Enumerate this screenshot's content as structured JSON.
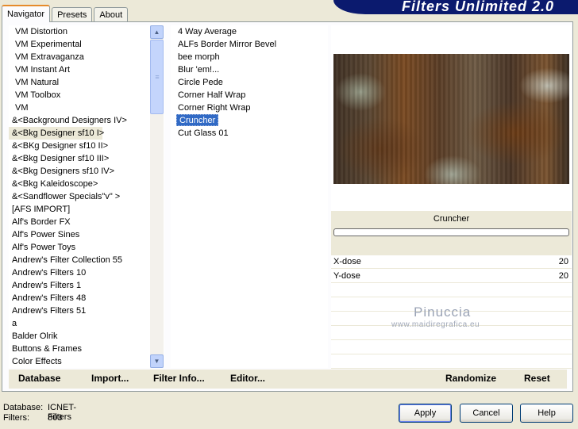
{
  "tabs": [
    {
      "label": "Navigator",
      "active": true
    },
    {
      "label": "Presets",
      "active": false
    },
    {
      "label": "About",
      "active": false
    }
  ],
  "banner": {
    "title": "Filters Unlimited 2.0",
    "color": "#0b1a6e"
  },
  "categories": {
    "items": [
      "VM Distortion",
      "VM Experimental",
      "VM Extravaganza",
      "VM Instant Art",
      "VM Natural",
      "VM Toolbox",
      "VM",
      "&<Background Designers IV>",
      "&<Bkg Designer sf10 I>",
      "&<BKg Designer sf10 II>",
      "&<Bkg Designer sf10 III>",
      "&<Bkg Designers sf10 IV>",
      "&<Bkg Kaleidoscope>",
      "&<Sandflower Specials\"v\" >",
      "[AFS IMPORT]",
      "Alf's Border FX",
      "Alf's Power Sines",
      "Alf's Power Toys",
      "Andrew's Filter Collection 55",
      "Andrew's Filters 10",
      "Andrew's Filters 1",
      "Andrew's Filters 48",
      "Andrew's Filters 51",
      "a",
      "Balder Olrik",
      "Buttons & Frames",
      "Color Effects"
    ],
    "current_index": 8
  },
  "filters": {
    "items": [
      "4 Way Average",
      "ALFs Border Mirror Bevel",
      "bee morph",
      "Blur 'em!...",
      "Circle Pede",
      "Corner Half Wrap",
      "Corner Right Wrap",
      "Cruncher",
      "Cut Glass 01"
    ],
    "selected_index": 7
  },
  "preview": {
    "filter_name": "Cruncher",
    "params": [
      {
        "label": "X-dose",
        "value": "20"
      },
      {
        "label": "Y-dose",
        "value": "20"
      }
    ],
    "watermark_name": "Pinuccia",
    "watermark_url": "www.maidiregrafica.eu"
  },
  "actions": {
    "database": "Database",
    "import": "Import...",
    "filter_info": "Filter Info...",
    "editor": "Editor...",
    "randomize": "Randomize",
    "reset": "Reset"
  },
  "status": {
    "database_label": "Database:",
    "database_value": "ICNET-Filters",
    "filters_label": "Filters:",
    "filters_value": "803"
  },
  "dialog_buttons": {
    "apply": "Apply",
    "cancel": "Cancel",
    "help": "Help"
  },
  "colors": {
    "selection": "#316ac5",
    "window_bg": "#ece9d8",
    "tab_highlight": "#e68b2c"
  }
}
